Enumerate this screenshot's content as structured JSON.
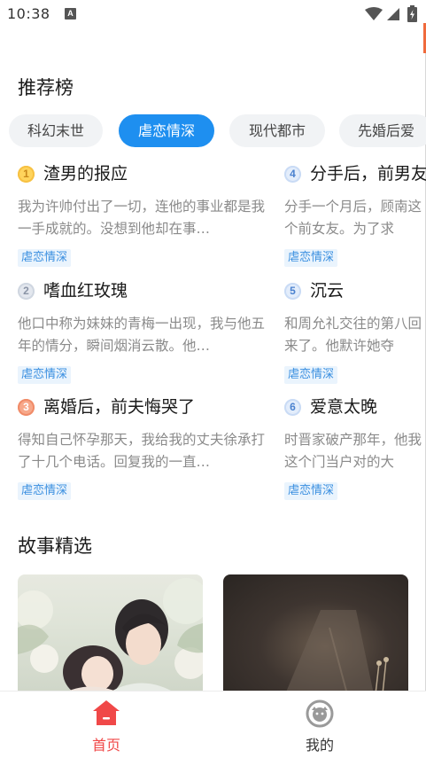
{
  "status_bar": {
    "time": "10:38",
    "indicator": "A"
  },
  "rank_section": {
    "title": "推荐榜"
  },
  "tabs": [
    {
      "label": "科幻末世",
      "active": false
    },
    {
      "label": "虐恋情深",
      "active": true
    },
    {
      "label": "现代都市",
      "active": false
    },
    {
      "label": "先婚后爱",
      "active": false
    }
  ],
  "rank_items": [
    {
      "rank": "1",
      "title": "渣男的报应",
      "desc": "我为许帅付出了一切，连他的事业都是我一手成就的。没想到他却在事…",
      "tag": "虐恋情深"
    },
    {
      "rank": "2",
      "title": "嗜血红玫瑰",
      "desc": "他口中称为妹妹的青梅一出现，我与他五年的情分，瞬间烟消云散。他…",
      "tag": "虐恋情深"
    },
    {
      "rank": "3",
      "title": "离婚后，前夫悔哭了",
      "desc": "得知自己怀孕那天，我给我的丈夫徐承打了十几个电话。回复我的一直…",
      "tag": "虐恋情深"
    },
    {
      "rank": "4",
      "title": "分手后，前男友",
      "desc": "分手一个月后，顾南这个前女友。为了求",
      "tag": "虐恋情深"
    },
    {
      "rank": "5",
      "title": "沉云",
      "desc": "和周允礼交往的第八回来了。他默许她夺",
      "tag": "虐恋情深"
    },
    {
      "rank": "6",
      "title": "爱意太晚",
      "desc": "时晋家破产那年，他我这个门当户对的大",
      "tag": "虐恋情深"
    }
  ],
  "story_section": {
    "title": "故事精选"
  },
  "nav": {
    "home_label": "首页",
    "mine_label": "我的",
    "active_color": "#f04848",
    "accent_color": "#1e8ff0"
  }
}
